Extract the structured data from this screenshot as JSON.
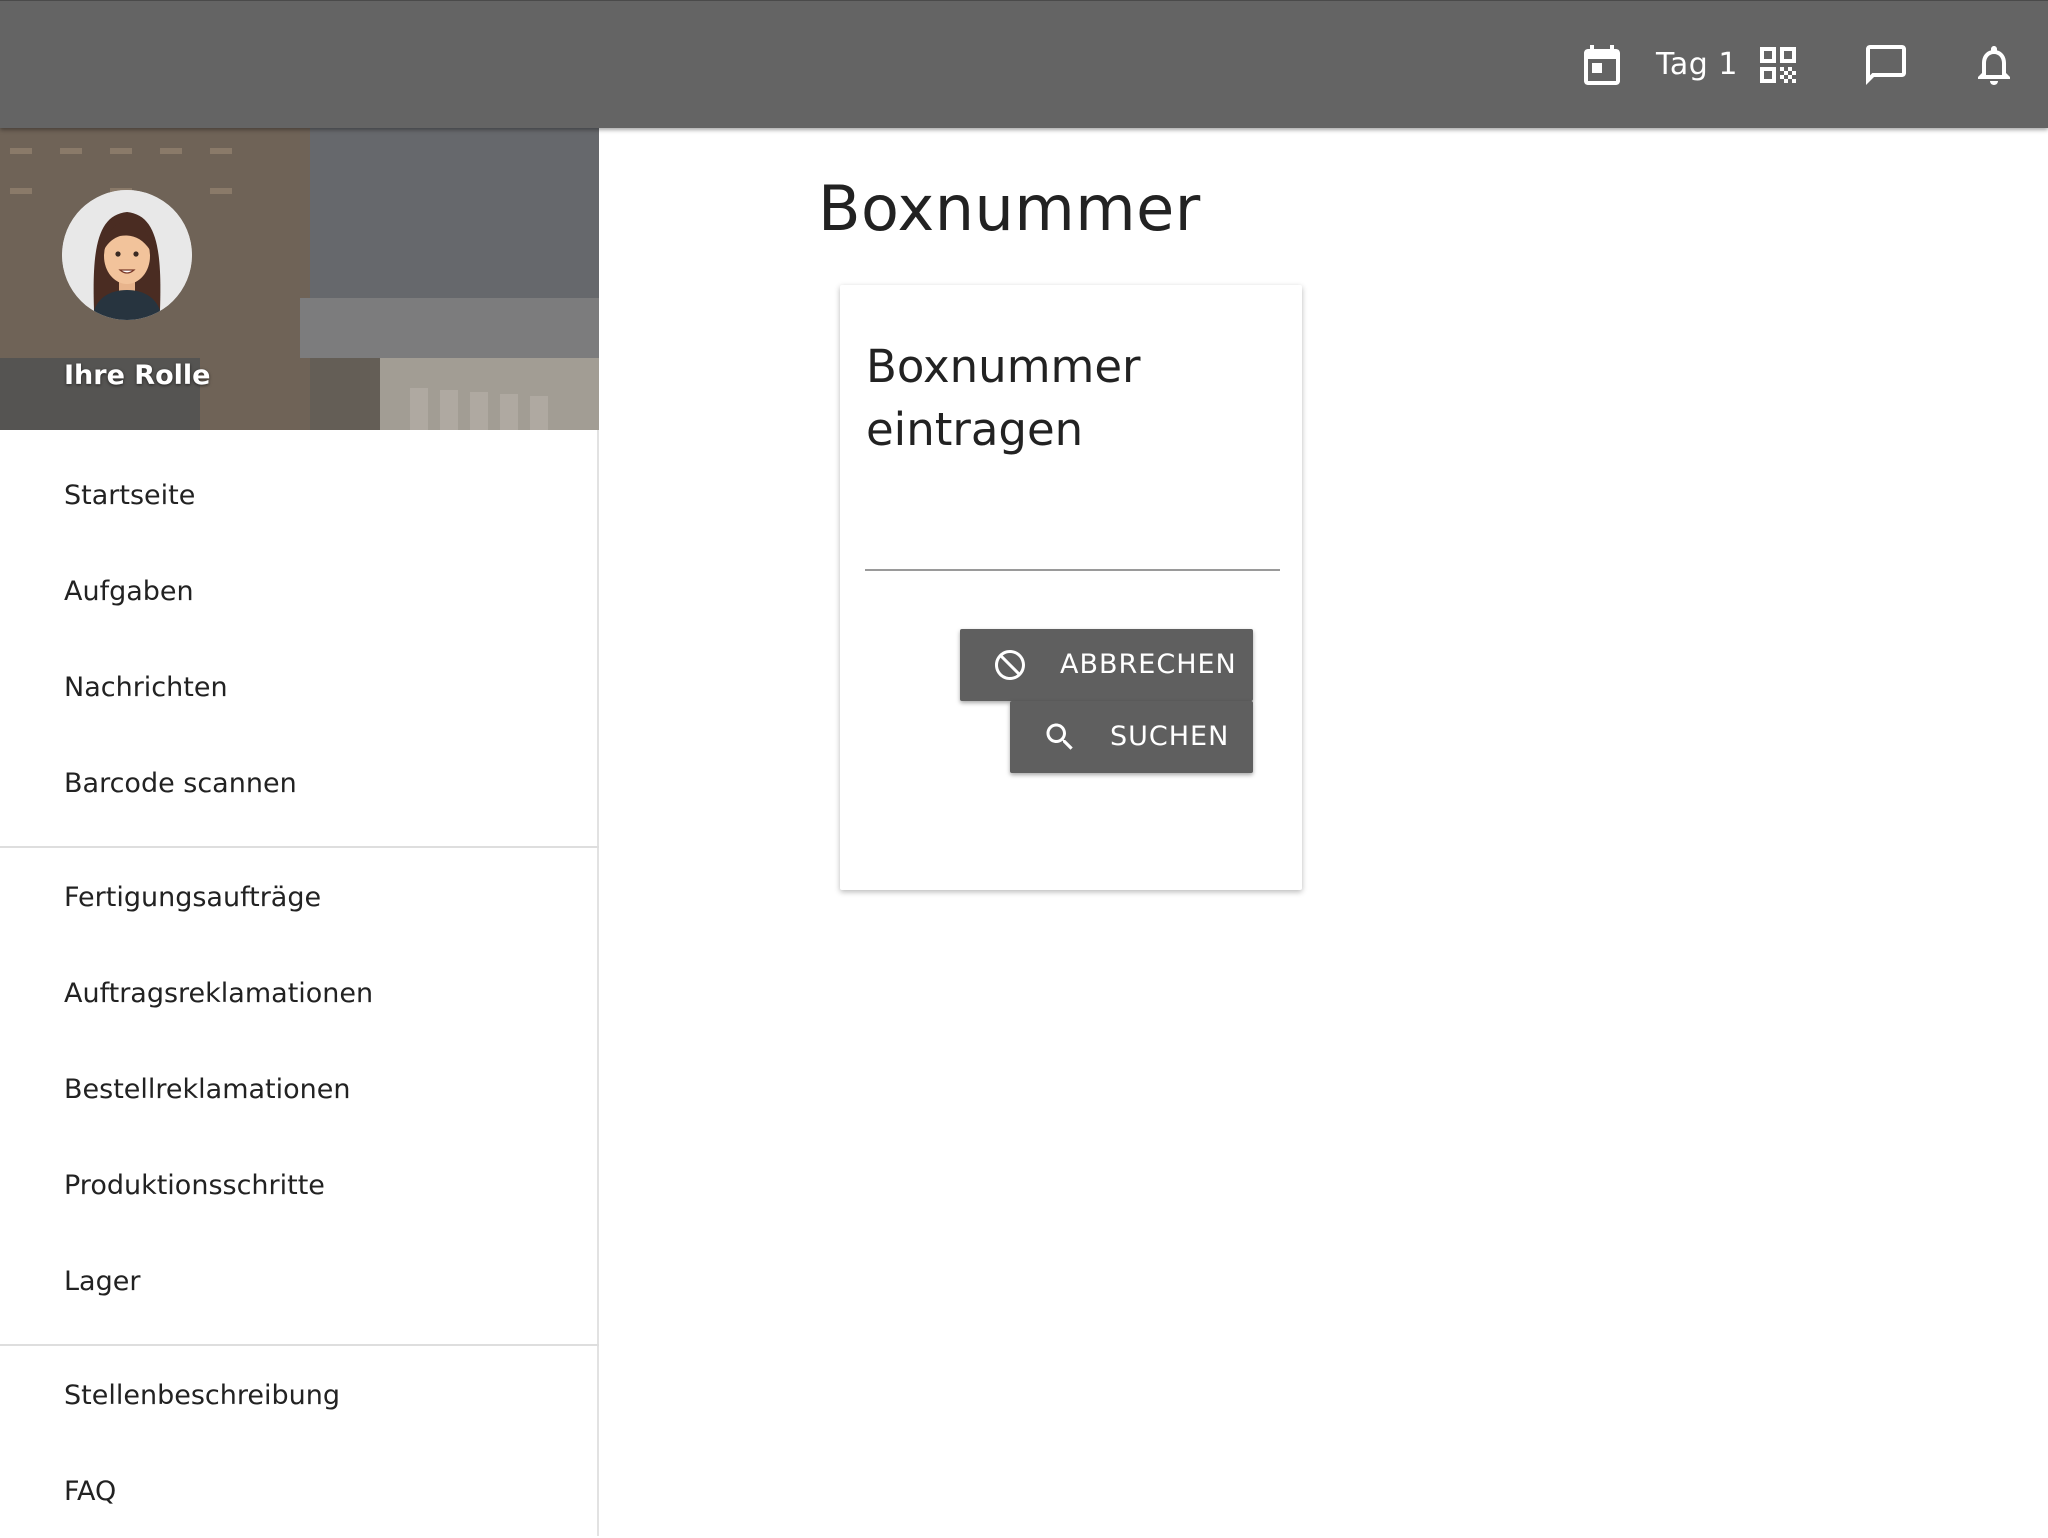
{
  "header": {
    "day_label": "Tag 1",
    "icons": [
      "calendar-icon",
      "qr-code-icon",
      "chat-icon",
      "bell-icon"
    ]
  },
  "sidebar": {
    "role_label": "Ihre Rolle",
    "groups": [
      [
        "Startseite",
        "Aufgaben",
        "Nachrichten",
        "Barcode scannen"
      ],
      [
        "Fertigungsaufträge",
        "Auftragsreklamationen",
        "Bestellreklamationen",
        "Produktionsschritte",
        "Lager"
      ],
      [
        "Stellenbeschreibung",
        "FAQ"
      ]
    ]
  },
  "main": {
    "title": "Boxnummer",
    "card": {
      "title": "Boxnummer eintragen",
      "input_value": "",
      "cancel_label": "ABBRECHEN",
      "search_label": "SUCHEN"
    }
  },
  "colors": {
    "appbar": "#646464",
    "button": "#5f5f5f"
  }
}
